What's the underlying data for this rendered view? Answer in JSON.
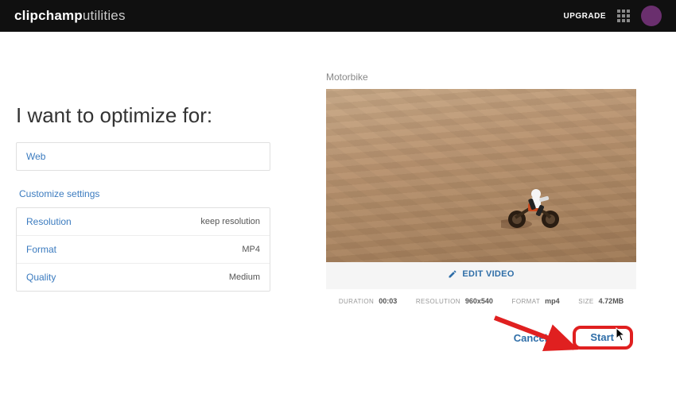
{
  "header": {
    "brand_bold": "clipchamp",
    "brand_light": "utilities",
    "upgrade": "UPGRADE"
  },
  "left": {
    "heading": "I want to optimize for:",
    "preset": "Web",
    "customize_label": "Customize settings",
    "settings": {
      "resolution": {
        "label": "Resolution",
        "value": "keep resolution"
      },
      "format": {
        "label": "Format",
        "value": "MP4"
      },
      "quality": {
        "label": "Quality",
        "value": "Medium"
      }
    }
  },
  "right": {
    "video_title": "Motorbike",
    "edit_label": "EDIT VIDEO",
    "meta": {
      "duration": {
        "label": "DURATION",
        "value": "00:03"
      },
      "resolution": {
        "label": "RESOLUTION",
        "value": "960x540"
      },
      "format": {
        "label": "FORMAT",
        "value": "mp4"
      },
      "size": {
        "label": "SIZE",
        "value": "4.72MB"
      }
    },
    "actions": {
      "cancel": "Cancel",
      "start": "Start"
    }
  }
}
